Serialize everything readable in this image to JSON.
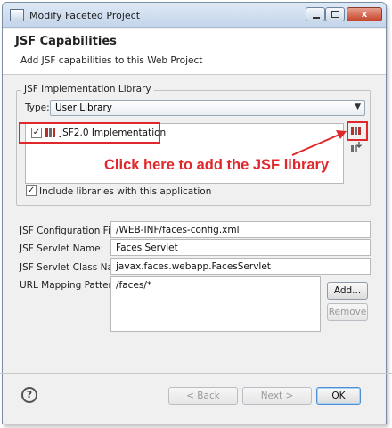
{
  "window": {
    "title": "Modify Faceted Project",
    "controls": {
      "minimize": "minimize",
      "maximize": "maximize",
      "close": "x"
    }
  },
  "header": {
    "title": "JSF Capabilities",
    "subtitle": "Add JSF capabilities to this Web Project"
  },
  "library_group": {
    "label": "JSF Implementation Library",
    "type_label": "Type:",
    "type_value": "User Library",
    "libraries": [
      {
        "label": "JSF2.0 Implementation",
        "checked": true
      }
    ],
    "include_label": "Include libraries with this application",
    "include_checked": true
  },
  "annotation": {
    "text": "Click here to add the JSF library",
    "color": "#e0282c"
  },
  "config": {
    "config_file_label": "JSF Configuration File:",
    "config_file_value": "/WEB-INF/faces-config.xml",
    "servlet_name_label": "JSF Servlet Name:",
    "servlet_name_value": "Faces Servlet",
    "servlet_class_label": "JSF Servlet Class Name:",
    "servlet_class_value": "javax.faces.webapp.FacesServlet",
    "url_patterns_label": "URL Mapping Patterns:",
    "url_patterns": [
      "/faces/*"
    ],
    "add_button": "Add...",
    "remove_button": "Remove"
  },
  "footer": {
    "help_icon": "?",
    "back_button": "< Back",
    "next_button": "Next >",
    "ok_button": "OK"
  },
  "icons": {
    "library": "library-stack-icon",
    "manage_library": "manage-library-icon",
    "download_library": "download-library-icon",
    "help": "help-icon"
  }
}
